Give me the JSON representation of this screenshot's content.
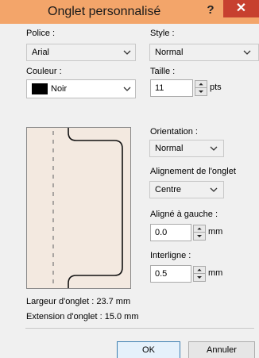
{
  "window": {
    "title": "Onglet personnalisé",
    "help": "?",
    "close": "✕"
  },
  "police": {
    "label": "Police :",
    "value": "Arial"
  },
  "style": {
    "label": "Style :",
    "value": "Normal"
  },
  "couleur": {
    "label": "Couleur :",
    "value": "Noir",
    "swatch_color": "#000000"
  },
  "taille": {
    "label": "Taille :",
    "value": "11",
    "unit": "pts"
  },
  "orientation": {
    "label": "Orientation :",
    "value": "Normal"
  },
  "alignement": {
    "label": "Alignement de l'onglet",
    "value": "Centre"
  },
  "aligne_gauche": {
    "label": "Aligné à gauche :",
    "value": "0.0",
    "unit": "mm"
  },
  "interligne": {
    "label": "Interligne :",
    "value": "0.5",
    "unit": "mm"
  },
  "info": {
    "largeur": "Largeur d'onglet : 23.7 mm",
    "extension": "Extension d'onglet : 15.0 mm"
  },
  "buttons": {
    "ok": "OK",
    "cancel": "Annuler"
  },
  "icons": {
    "chevron": "chevron-down-icon",
    "spin_up": "spin-up-icon",
    "spin_down": "spin-down-icon",
    "close": "close-icon",
    "help": "help-icon"
  }
}
